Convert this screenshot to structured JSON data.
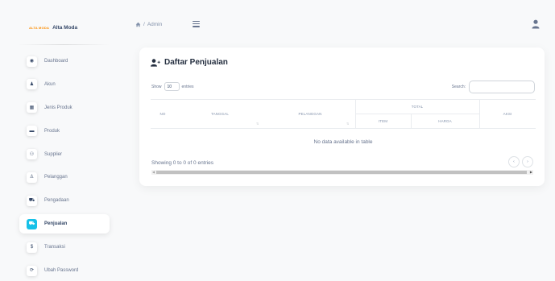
{
  "brand": {
    "logo_text": "ALTA MODA",
    "name": "Alta Moda"
  },
  "breadcrumb": {
    "separator": "/",
    "current": "Admin"
  },
  "sidebar": {
    "items": [
      {
        "label": "Dashboard",
        "glyph": "◉",
        "icon": "dashboard-icon"
      },
      {
        "label": "Akun",
        "glyph": "♟",
        "icon": "user-icon"
      },
      {
        "label": "Jenis Produk",
        "glyph": "▦",
        "icon": "table-icon"
      },
      {
        "label": "Produk",
        "glyph": "▬",
        "icon": "box-icon"
      },
      {
        "label": "Supplier",
        "glyph": "⚇",
        "icon": "users-icon"
      },
      {
        "label": "Pelanggan",
        "glyph": "♙",
        "icon": "user-plus-icon"
      },
      {
        "label": "Pengadaan",
        "glyph": "⛟",
        "icon": "cart-icon"
      },
      {
        "label": "Penjualan",
        "glyph": "⛟",
        "icon": "cart-icon",
        "active": true
      },
      {
        "label": "Transaksi",
        "glyph": "$",
        "icon": "dollar-icon"
      },
      {
        "label": "Ubah Password",
        "glyph": "⟳",
        "icon": "sync-icon"
      }
    ]
  },
  "card": {
    "title": "Daftar Penjualan",
    "show_prefix": "Show",
    "show_value": "10",
    "show_suffix": "entries",
    "search_label": "Search:",
    "search_value": "",
    "table_headers": {
      "no": "NO",
      "tanggal": "TANGGAL",
      "pelanggan": "PELANGGAN",
      "total": "TOTAL",
      "item": "ITEM",
      "harga": "HARGA",
      "aksi": "AKSI"
    },
    "empty_message": "No data available in table",
    "info": "Showing 0 to 0 of 0 entries",
    "prev": "‹",
    "next": "›"
  },
  "colors": {
    "accent": "#17c1e8",
    "text": "#344767",
    "muted": "#67748e",
    "bg": "#f8f9fa"
  }
}
